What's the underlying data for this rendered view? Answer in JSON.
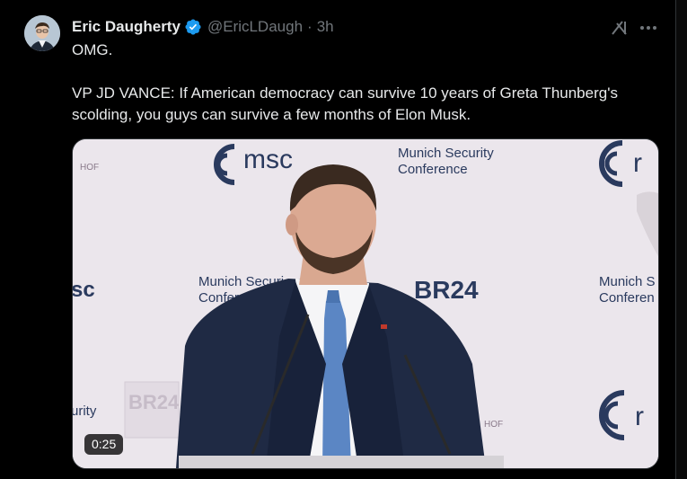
{
  "post": {
    "author_name": "Eric Daugherty",
    "handle": "@EricLDaugh",
    "separator": "·",
    "time_ago": "3h",
    "text_line1": "OMG.",
    "text_line2": "VP JD VANCE: If American democracy can survive 10 years of Greta Thunberg's scolding, you guys can survive a few months of Elon Musk."
  },
  "media": {
    "video_duration": "0:25",
    "backdrop": {
      "msc_logo": "msc",
      "msc_partial_left": "sc",
      "msc_partial_right": "r",
      "conference_line1": "Munich Security",
      "conference_line2": "Conference",
      "conference_mid_line1": "Munich Securi",
      "conference_mid_line2": "Conferen",
      "conference_right_line1": "Munich S",
      "conference_right_line2": "Conferen",
      "br24": "BR24",
      "br24_small": "BR24",
      "urity": "urity",
      "hof_left": "HOF",
      "hof_right": "HOF"
    }
  },
  "icons": {
    "verified": "verified-badge-icon",
    "grok": "grok-icon",
    "more": "more-options-icon"
  },
  "colors": {
    "background": "#000000",
    "text": "#e7e9ea",
    "muted": "#71767b",
    "verified": "#1d9bf0",
    "msc_navy": "#2a3a5e"
  }
}
